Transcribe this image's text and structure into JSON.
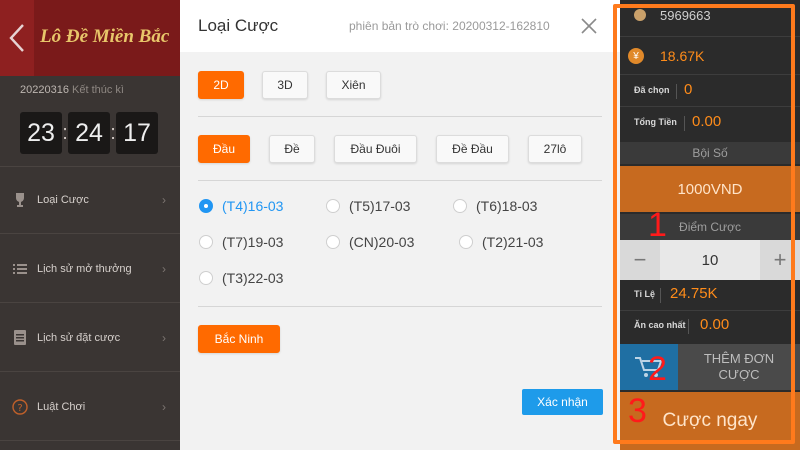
{
  "sidebar": {
    "title": "Lô Đề Miền Bắc",
    "date": "20220316",
    "date_suffix": "Kết thúc kì",
    "clock": {
      "hours": "23",
      "minutes": "24",
      "seconds": "17"
    },
    "items": [
      {
        "label": "Loại Cược",
        "icon": "trophy-icon"
      },
      {
        "label": "Lịch sử mở thưởng",
        "icon": "list-icon"
      },
      {
        "label": "Lịch sử đặt cược",
        "icon": "document-icon"
      },
      {
        "label": "Luật Chơi",
        "icon": "help-icon"
      }
    ]
  },
  "modal": {
    "title": "Loại Cược",
    "version": "phiên bản trò chơi: 20200312-162810",
    "type_tabs": [
      "2D",
      "3D",
      "Xiên"
    ],
    "type_active": 0,
    "bet_tabs": [
      "Đầu",
      "Đề",
      "Đầu Đuôi",
      "Đề Đầu",
      "27lô"
    ],
    "bet_active": 0,
    "dates": [
      "(T4)16-03",
      "(T5)17-03",
      "(T6)18-03",
      "(T7)19-03",
      "(CN)20-03",
      "(T2)21-03",
      "(T3)22-03"
    ],
    "date_selected": 0,
    "region": "Bắc Ninh",
    "confirm": "Xác nhận"
  },
  "panel": {
    "balance": "5969663",
    "amount": "18.67K",
    "selected_label": "Đã chọn",
    "selected_value": "0",
    "total_label": "Tổng Tiền",
    "total_value": "0.00",
    "multiplier_label": "Bội Số",
    "unit": "1000VND",
    "points_label": "Điểm Cược",
    "points_value": "10",
    "rate_label": "Tỉ Lệ",
    "rate_value": "24.75K",
    "max_win_label": "Ăn cao nhất",
    "max_win_value": "0.00",
    "add_order_line1": "THÊM ĐƠN",
    "add_order_line2": "CƯỢC",
    "bet_now": "Cược ngay"
  },
  "annotations": [
    "1",
    "2",
    "3"
  ],
  "colors": {
    "accent": "#ff6a00",
    "annotation": "#ff1a1a",
    "confirm": "#1e9bea",
    "header": "#7a1a1a"
  }
}
